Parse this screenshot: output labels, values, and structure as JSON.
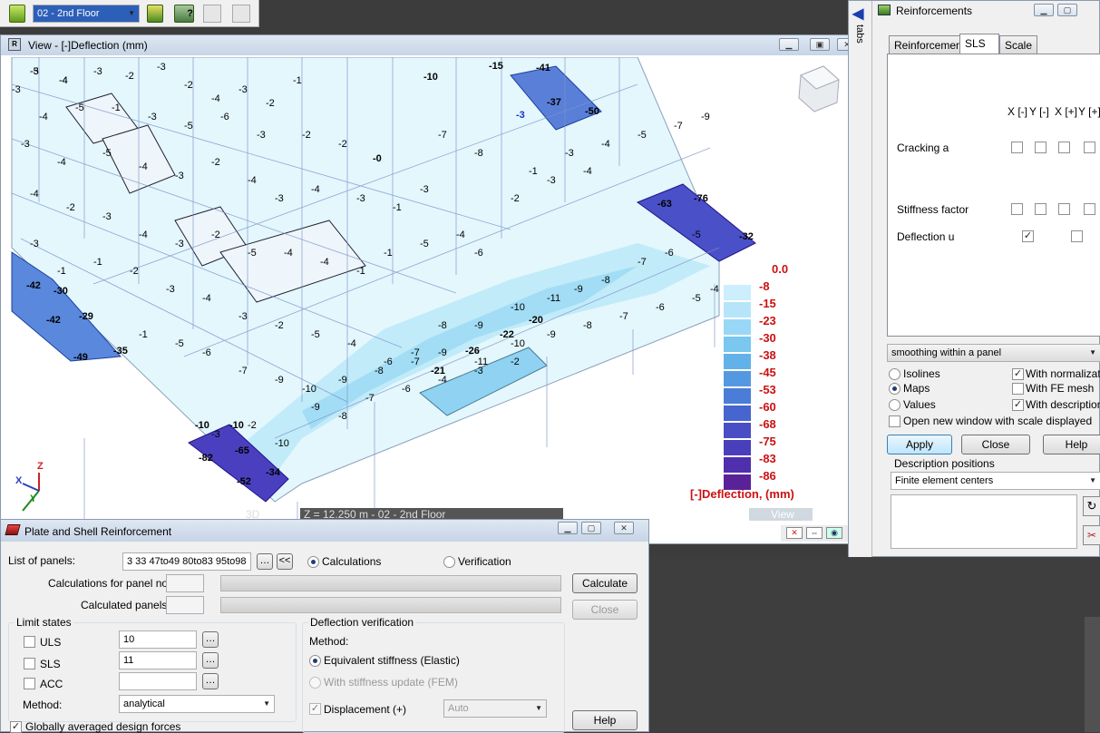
{
  "toolbar": {
    "story_select": "02 - 2nd Floor",
    "icons": [
      "story-up-icon",
      "story-help-icon",
      "story-copy-icon",
      "story-paste-icon"
    ]
  },
  "view_window": {
    "title": "View - [-]Deflection (mm)",
    "status_left": "3D",
    "status_center": "Z = 12.250 m - 02 - 2nd Floor",
    "status_right": "View",
    "map_values": [
      {
        "t": "-3"
      },
      {
        "t": "-4"
      },
      {
        "t": "-3"
      },
      {
        "t": "-2"
      },
      {
        "t": "-3"
      },
      {
        "t": "-2"
      },
      {
        "t": "-4"
      },
      {
        "t": "-3"
      },
      {
        "t": "-2"
      },
      {
        "t": "-1"
      },
      {
        "t": "-3"
      },
      {
        "t": "-4"
      },
      {
        "t": "-5"
      },
      {
        "t": "-1"
      },
      {
        "t": "-3"
      },
      {
        "t": "-5"
      },
      {
        "t": "-6"
      },
      {
        "t": "-3"
      },
      {
        "t": "-2"
      },
      {
        "t": "-2"
      },
      {
        "t": "-3"
      },
      {
        "t": "-4"
      },
      {
        "t": "-5"
      },
      {
        "t": "-4"
      },
      {
        "t": "-3"
      },
      {
        "t": "-2"
      },
      {
        "t": "-4"
      },
      {
        "t": "-3"
      },
      {
        "t": "-4"
      },
      {
        "t": "-3"
      },
      {
        "t": "-1"
      },
      {
        "t": "-3"
      },
      {
        "t": "-4"
      },
      {
        "t": "-2"
      },
      {
        "t": "-3"
      },
      {
        "t": "-4"
      },
      {
        "t": "-3"
      },
      {
        "t": "-2"
      },
      {
        "t": "-5"
      },
      {
        "t": "-4"
      },
      {
        "t": "-4"
      },
      {
        "t": "-1"
      },
      {
        "t": "-1"
      },
      {
        "t": "-5"
      },
      {
        "t": "-4"
      },
      {
        "t": "-6"
      },
      {
        "t": "-3"
      },
      {
        "t": "-1"
      },
      {
        "t": "-1"
      },
      {
        "t": "-2"
      },
      {
        "t": "-3"
      },
      {
        "t": "-4"
      },
      {
        "t": "-3"
      },
      {
        "t": "-2"
      },
      {
        "t": "-5"
      },
      {
        "t": "-4"
      },
      {
        "t": "-6"
      },
      {
        "t": "-7"
      },
      {
        "t": "-8"
      },
      {
        "t": "-9"
      },
      {
        "t": "-10"
      },
      {
        "t": "-11"
      },
      {
        "t": "-9"
      },
      {
        "t": "-8"
      },
      {
        "t": "-7"
      },
      {
        "t": "-6"
      },
      {
        "t": "-5"
      },
      {
        "t": "-4"
      },
      {
        "t": "-3"
      },
      {
        "t": "-2"
      },
      {
        "t": "-1"
      },
      {
        "t": "-5"
      },
      {
        "t": "-6"
      },
      {
        "t": "-7"
      },
      {
        "t": "-9"
      },
      {
        "t": "-10"
      },
      {
        "t": "-9"
      },
      {
        "t": "-8"
      },
      {
        "t": "-7"
      },
      {
        "t": "-9"
      },
      {
        "t": "-11"
      },
      {
        "t": "-10"
      },
      {
        "t": "-9"
      },
      {
        "t": "-8"
      },
      {
        "t": "-7"
      },
      {
        "t": "-6"
      },
      {
        "t": "-5"
      },
      {
        "t": "-4"
      },
      {
        "t": "-3"
      },
      {
        "t": "-2"
      },
      {
        "t": "-10"
      },
      {
        "t": "-9"
      },
      {
        "t": "-8"
      },
      {
        "t": "-7"
      },
      {
        "t": "-6"
      },
      {
        "t": "-4"
      },
      {
        "t": "-3"
      },
      {
        "t": "-2"
      },
      {
        "t": "-1"
      },
      {
        "t": "-3"
      },
      {
        "t": "-4"
      },
      {
        "t": "-5"
      },
      {
        "t": "-7"
      },
      {
        "t": "-9"
      },
      {
        "t": "-8"
      },
      {
        "t": "-7"
      },
      {
        "t": "-5"
      },
      {
        "t": "-4"
      }
    ],
    "bold_values": [
      {
        "t": "-41"
      },
      {
        "t": "-37"
      },
      {
        "t": "-50"
      },
      {
        "t": "-15"
      },
      {
        "t": "-10"
      },
      {
        "t": "-76"
      },
      {
        "t": "-63"
      },
      {
        "t": "-32"
      },
      {
        "t": "-42"
      },
      {
        "t": "-30"
      },
      {
        "t": "-42"
      },
      {
        "t": "-29"
      },
      {
        "t": "-49"
      },
      {
        "t": "-35"
      },
      {
        "t": "-26"
      },
      {
        "t": "-22"
      },
      {
        "t": "-20"
      },
      {
        "t": "-21"
      },
      {
        "t": "-82"
      },
      {
        "t": "-65"
      },
      {
        "t": "-34"
      },
      {
        "t": "-52"
      },
      {
        "t": "-10"
      },
      {
        "t": "-10"
      },
      {
        "t": "-0"
      },
      {
        "t": "-3"
      }
    ],
    "legend": {
      "values": [
        "0.0",
        "-8",
        "-15",
        "-23",
        "-30",
        "-38",
        "-45",
        "-53",
        "-60",
        "-68",
        "-75",
        "-83",
        "-86"
      ],
      "colors": [
        "#ffffff",
        "#cdeefc",
        "#b6e5fa",
        "#98d8f6",
        "#7ac7f0",
        "#62b2ea",
        "#5598e2",
        "#4a7dd8",
        "#4665cf",
        "#4a4ec5",
        "#4a3fba",
        "#4f2fae",
        "#5a2299"
      ],
      "caption": "[-]Deflection, (mm)"
    }
  },
  "reinforcements_panel": {
    "title": "Reinforcements",
    "side_tab": "tabs",
    "tabs": [
      "Reinforcement",
      "SLS",
      "Scale"
    ],
    "col_headers": [
      "X [-]",
      "Y [-]",
      "X [+]",
      "Y [+]"
    ],
    "rows": [
      {
        "label": "Cracking a",
        "checks": [
          false,
          false,
          false,
          false
        ]
      },
      {
        "label": "Stiffness factor",
        "checks": [
          false,
          false,
          false,
          false
        ]
      },
      {
        "label": "Deflection u",
        "checks": [
          true,
          false
        ]
      }
    ],
    "smoothing": "smoothing within a panel",
    "opt_isolines": "Isolines",
    "opt_maps": "Maps",
    "opt_values": "Values",
    "opt_normalization": "With normalization",
    "opt_fe_mesh": "With FE mesh",
    "opt_description": "With description",
    "opt_new_window": "Open new window with scale displayed",
    "btn_apply": "Apply",
    "btn_close": "Close",
    "btn_help": "Help",
    "desc_positions": "Description positions",
    "desc_select": "Finite element centers"
  },
  "plate_dialog": {
    "title": "Plate and Shell Reinforcement",
    "list_label": "List of panels:",
    "list_value": "3 33 47to49 80to83 95to98",
    "radio_calc": "Calculations",
    "radio_verif": "Verification",
    "calc_for_label": "Calculations for panel no.:",
    "calculated_label": "Calculated panels:",
    "btn_calculate": "Calculate",
    "btn_close": "Close",
    "btn_help": "Help",
    "limit_states": "Limit states",
    "uls": "ULS",
    "uls_val": "10",
    "sls": "SLS",
    "sls_val": "11",
    "acc": "ACC",
    "acc_val": "",
    "method_label": "Method:",
    "method_value": "analytical",
    "deflection_verif": "Deflection verification",
    "dv_method": "Method:",
    "equiv_stiffness": "Equivalent stiffness (Elastic)",
    "stiffness_update": "With stiffness update (FEM)",
    "displacement": "Displacement (+)",
    "disp_select": "Auto",
    "globally": "Globally averaged design forces"
  }
}
